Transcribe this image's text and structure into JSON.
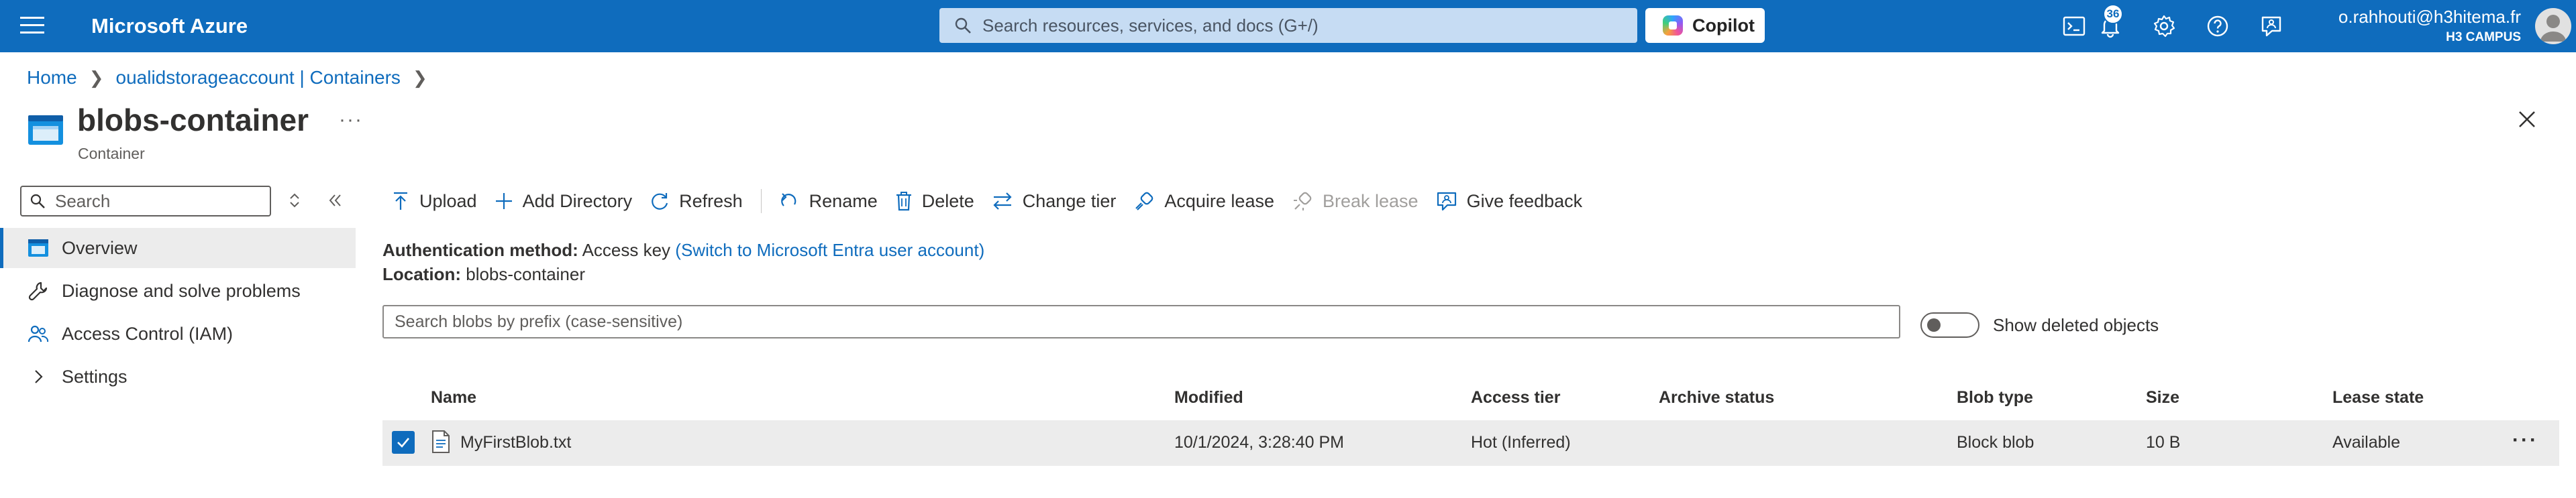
{
  "topbar": {
    "brand": "Microsoft Azure",
    "search_placeholder": "Search resources, services, and docs (G+/)",
    "copilot_label": "Copilot",
    "notification_count": "36",
    "account_email": "o.rahhouti@h3hitema.fr",
    "account_tenant": "H3 CAMPUS",
    "icons": [
      "menu-icon",
      "cloud-shell-icon",
      "notifications-icon",
      "settings-icon",
      "help-icon",
      "feedback-icon"
    ]
  },
  "breadcrumb": {
    "items": [
      "Home",
      "oualidstorageaccount | Containers"
    ]
  },
  "header": {
    "title": "blobs-container",
    "subtitle": "Container",
    "more": "···"
  },
  "nav": {
    "search_placeholder": "Search",
    "items": [
      {
        "label": "Overview",
        "icon": "overview-icon",
        "active": true
      },
      {
        "label": "Diagnose and solve problems",
        "icon": "wrench-icon"
      },
      {
        "label": "Access Control (IAM)",
        "icon": "people-icon"
      },
      {
        "label": "Settings",
        "icon": "chevron-right-icon"
      }
    ]
  },
  "toolbar": {
    "upload": "Upload",
    "add_directory": "Add Directory",
    "refresh": "Refresh",
    "rename": "Rename",
    "delete": "Delete",
    "change_tier": "Change tier",
    "acquire_lease": "Acquire lease",
    "break_lease": "Break lease",
    "give_feedback": "Give feedback"
  },
  "info": {
    "auth_label": "Authentication method:",
    "auth_value": "Access key",
    "auth_link": "(Switch to Microsoft Entra user account)",
    "location_label": "Location:",
    "location_value": "blobs-container"
  },
  "filter": {
    "placeholder": "Search blobs by prefix (case-sensitive)",
    "show_deleted_label": "Show deleted objects",
    "show_deleted": false
  },
  "table": {
    "columns": [
      "Name",
      "Modified",
      "Access tier",
      "Archive status",
      "Blob type",
      "Size",
      "Lease state"
    ],
    "rows": [
      {
        "selected": true,
        "name": "MyFirstBlob.txt",
        "modified": "10/1/2024, 3:28:40 PM",
        "access_tier": "Hot (Inferred)",
        "archive_status": "",
        "blob_type": "Block blob",
        "size": "10 B",
        "lease_state": "Available"
      }
    ]
  },
  "colors": {
    "accent": "#0f6cbd",
    "selected_row": "#ececec",
    "text": "#323130",
    "disabled": "#a19f9d"
  }
}
